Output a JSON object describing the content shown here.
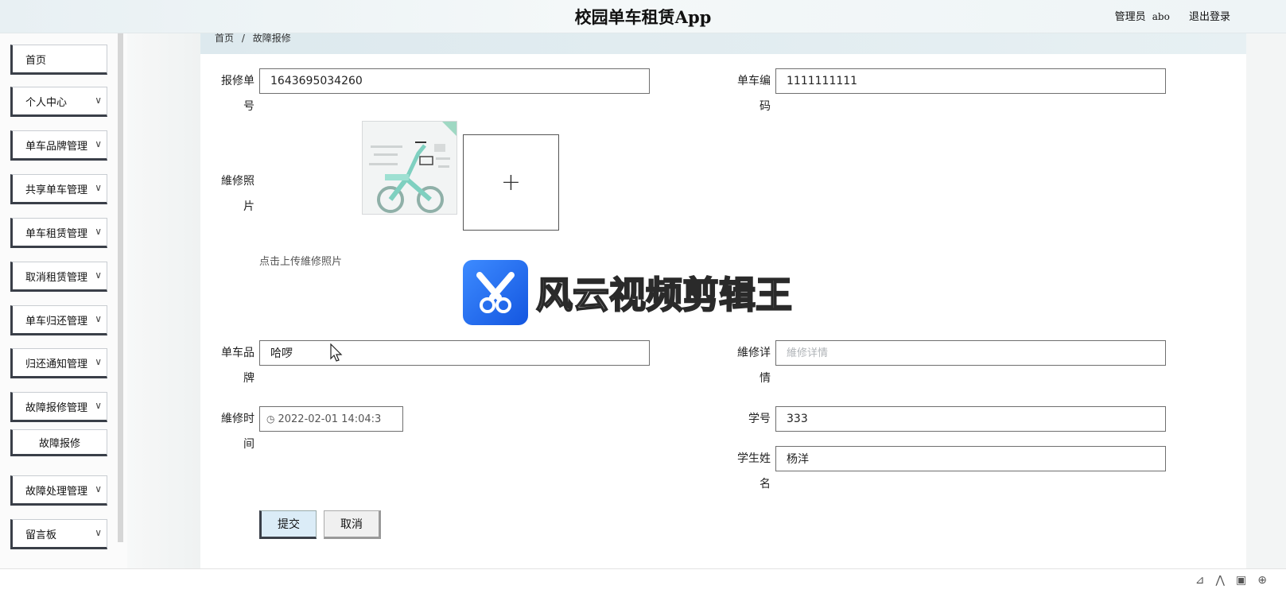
{
  "header": {
    "app_title": "校园单车租赁App",
    "user_role": "管理员",
    "user_name": "abo",
    "logout_label": "退出登录"
  },
  "sidebar": {
    "items": [
      {
        "label": "首页",
        "has_children": false
      },
      {
        "label": "个人中心",
        "has_children": true
      },
      {
        "label": "单车品牌管理",
        "has_children": true
      },
      {
        "label": "共享单车管理",
        "has_children": true
      },
      {
        "label": "单车租赁管理",
        "has_children": true
      },
      {
        "label": "取消租赁管理",
        "has_children": true
      },
      {
        "label": "单车归还管理",
        "has_children": true
      },
      {
        "label": "归还通知管理",
        "has_children": true
      },
      {
        "label": "故障报修管理",
        "has_children": true
      },
      {
        "label": "故障报修",
        "is_sub": true
      },
      {
        "label": "故障处理管理",
        "has_children": true
      },
      {
        "label": "留言板",
        "has_children": true
      }
    ]
  },
  "breadcrumb": {
    "home": "首页",
    "separator": "/",
    "current": "故障报修"
  },
  "form": {
    "repair_no": {
      "label": "报修单号",
      "value": "1643695034260"
    },
    "bike_code": {
      "label": "单车编码",
      "value": "1111111111"
    },
    "repair_photo": {
      "label": "維修照片",
      "upload_hint": "点击上传維修照片",
      "upload_icon": "+"
    },
    "bike_brand": {
      "label": "单车品牌",
      "value": "哈啰"
    },
    "repair_detail": {
      "label": "維修详情",
      "value": "",
      "placeholder": "維修详情"
    },
    "repair_time": {
      "label": "維修时间",
      "value": "2022-02-01 14:04:3"
    },
    "student_no": {
      "label": "学号",
      "value": "333"
    },
    "student_name": {
      "label": "学生姓名",
      "value": "杨洋"
    }
  },
  "buttons": {
    "submit": "提交",
    "cancel": "取消"
  },
  "watermark": {
    "text": "风云视频剪辑王"
  },
  "colors": {
    "menu_border": "#3a3f48",
    "submit_bg": "#dbecf7",
    "watermark_blue": "#1e6bff"
  }
}
